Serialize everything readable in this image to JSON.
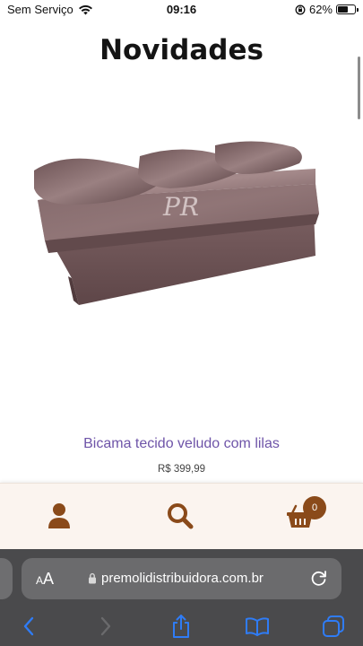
{
  "status_bar": {
    "carrier": "Sem Serviço",
    "time": "09:16",
    "battery": "62%",
    "battery_level": 0.62
  },
  "page": {
    "title": "Novidades"
  },
  "product": {
    "name": "Bicama tecido veludo com lilas",
    "price": "R$ 399,99",
    "image_watermark": "PR"
  },
  "app_nav": {
    "cart_count": "0",
    "items": [
      "user-icon",
      "search-icon",
      "cart-icon"
    ]
  },
  "browser": {
    "aa_label_small": "A",
    "aa_label_large": "A",
    "url": "premolidistribuidora.com.br"
  },
  "colors": {
    "accent": "#8a4a1a",
    "product_name": "#6e54a8",
    "nav_background": "#fbf4ef",
    "browser_chrome": "#4a4a4c",
    "ios_blue": "#2f7cf6"
  }
}
